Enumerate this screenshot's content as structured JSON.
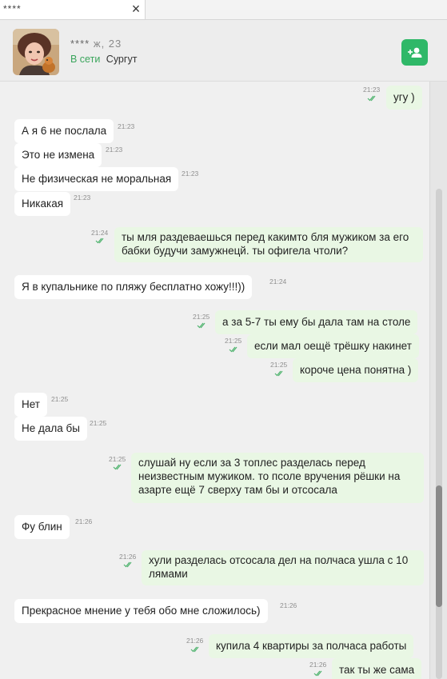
{
  "tab": {
    "title": "****"
  },
  "header": {
    "name": "****",
    "details": "ж, 23",
    "status": "В сети",
    "city": "Сургут"
  },
  "colors": {
    "accent_green": "#2fb868",
    "online": "#3ba55c",
    "outgoing_bg": "#e9f7e4",
    "incoming_bg": "#ffffff"
  },
  "icons": {
    "add_contact": "add-person-icon",
    "read_status": "double-check-icon",
    "close_tab": "close-icon"
  },
  "messages": [
    {
      "dir": "out",
      "text": "угу )",
      "time": "21:23"
    },
    {
      "dir": "in",
      "text": "А я 6 не послала",
      "time": "21:23"
    },
    {
      "dir": "in",
      "text": "Это не измена",
      "time": "21:23"
    },
    {
      "dir": "in",
      "text": "Не физическая не моральная",
      "time": "21:23"
    },
    {
      "dir": "in",
      "text": "Никакая",
      "time": "21:23"
    },
    {
      "dir": "out",
      "text": "ты мля раздеваешься перед какимто бля мужиком за его бабки будучи замужнецй. ты офигела чтоли?",
      "time": "21:24"
    },
    {
      "dir": "in",
      "text": "Я в купальнике по пляжу бесплатно хожу!!!))",
      "time": "21:24"
    },
    {
      "dir": "out",
      "text": "а за 5-7 ты ему бы дала там на столе",
      "time": "21:25"
    },
    {
      "dir": "out",
      "text": "если мал оещё трёшку накинет",
      "time": "21:25"
    },
    {
      "dir": "out",
      "text": "короче цена понятна )",
      "time": "21:25"
    },
    {
      "dir": "in",
      "text": "Нет",
      "time": "21:25"
    },
    {
      "dir": "in",
      "text": "Не дала бы",
      "time": "21:25"
    },
    {
      "dir": "out",
      "text": "слушай ну если за 3 топлес разделась перед неизвестным мужиком. то псоле вручения рёшки на азарте ещё 7 сверху там бы и отсосала",
      "time": "21:25"
    },
    {
      "dir": "in",
      "text": "Фу блин",
      "time": "21:26"
    },
    {
      "dir": "out",
      "text": "хули разделась отсосала дел на полчаса ушла с 10 лямами",
      "time": "21:26"
    },
    {
      "dir": "in",
      "text": "Прекрасное мнение у тебя обо мне сложилось)",
      "time": "21:26"
    },
    {
      "dir": "out",
      "text": "купила 4 квартиры за полчаса работы",
      "time": "21:26"
    },
    {
      "dir": "out",
      "text": "так ты же сама",
      "time": "21:26"
    }
  ]
}
